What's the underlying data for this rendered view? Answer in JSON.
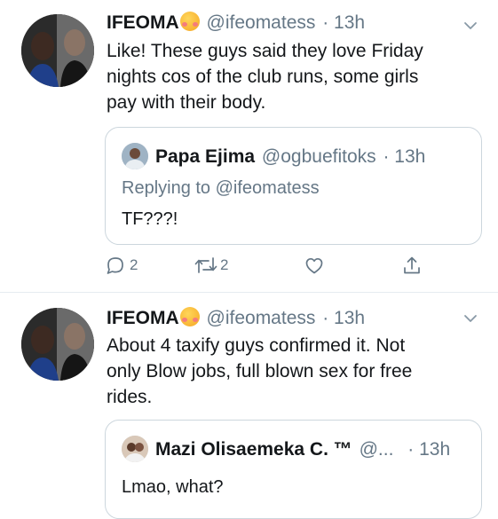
{
  "tweets": [
    {
      "name": "IFEOMA",
      "emoji": "smiling-face-with-hearts-emoji",
      "handle": "@ifeomatess",
      "time": "· 13h",
      "lines": [
        "Like! These guys said they love Friday",
        "nights cos of the club runs, some girls",
        "pay with their body."
      ],
      "quote": {
        "name": "Papa Ejima",
        "handle": "@ogbuefitoks",
        "time": "· 13h",
        "replying_to": "Replying to @ifeomatess",
        "text": "TF???!"
      },
      "actions": {
        "reply_count": "2",
        "retweet_count": "2",
        "like_count": "",
        "icons": [
          "reply-icon",
          "retweet-icon",
          "like-icon",
          "share-icon"
        ]
      }
    },
    {
      "name": "IFEOMA",
      "emoji": "smiling-face-with-hearts-emoji",
      "handle": "@ifeomatess",
      "time": "· 13h",
      "lines": [
        "About 4 taxify guys confirmed it. Not",
        "only Blow jobs, full blown sex for free",
        "rides."
      ],
      "quote": {
        "name": "Mazi Olisaemeka C. ™",
        "handle": "@...",
        "time": "· 13h",
        "text": "Lmao, what?"
      }
    }
  ],
  "colors": {
    "text": "#14171a",
    "secondary": "#657786",
    "border": "#ccd6dd",
    "divider": "#e6ecf0"
  }
}
